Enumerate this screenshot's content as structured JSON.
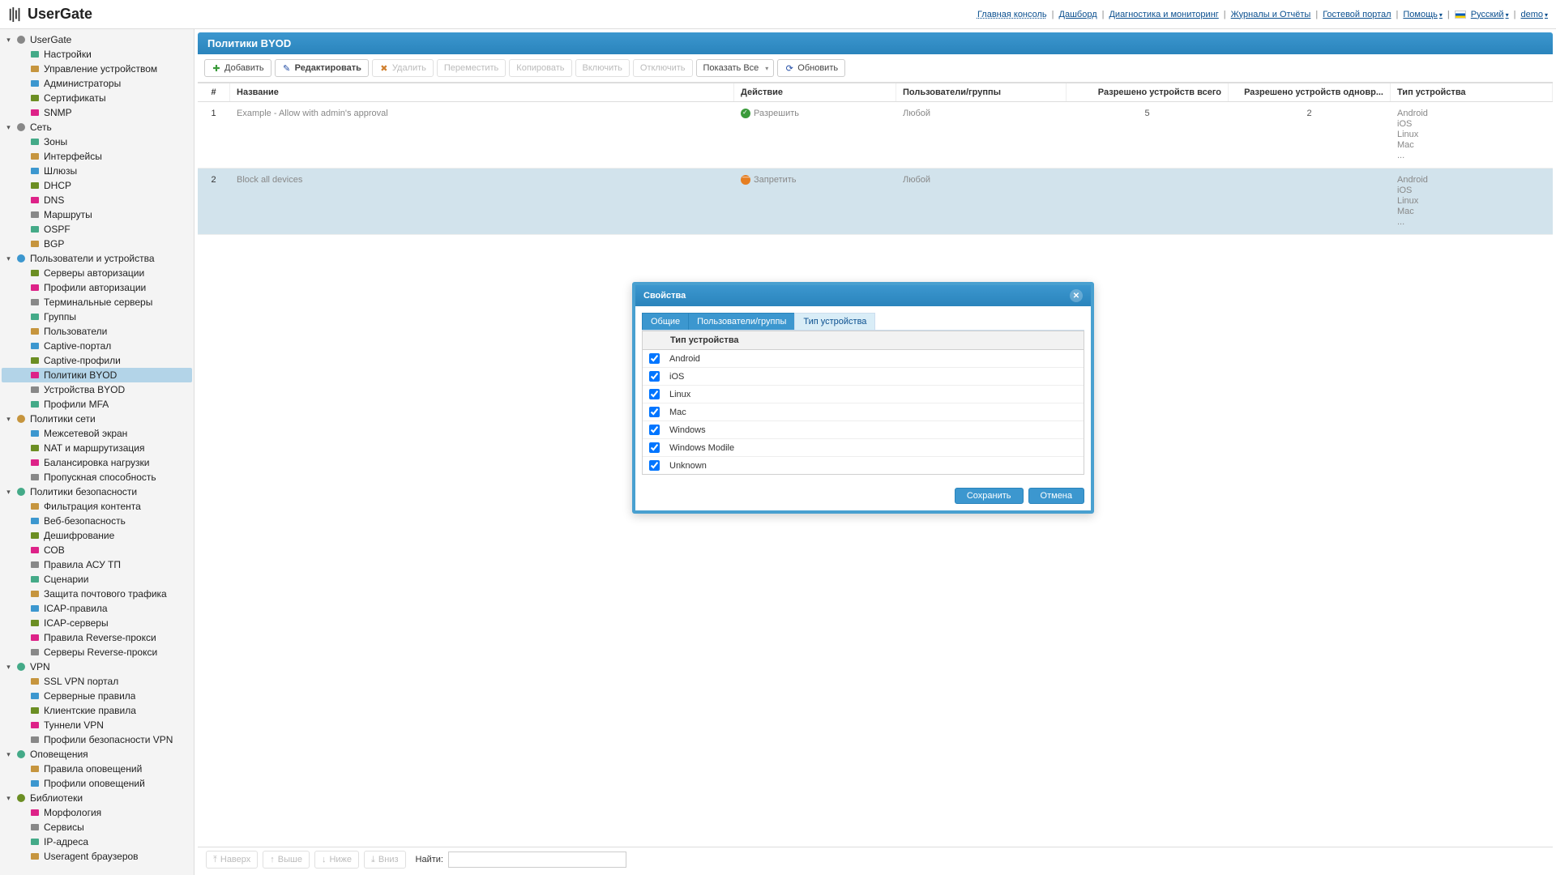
{
  "logo_text": "UserGate",
  "topnav": {
    "main_console": "Главная консоль",
    "dashboard": "Дашборд",
    "diagnostics": "Диагностика и мониторинг",
    "logs_reports": "Журналы и Отчёты",
    "guest_portal": "Гостевой портал",
    "help": "Помощь",
    "language": "Русский",
    "user": "demo"
  },
  "sidebar": [
    {
      "id": "usergate",
      "label": "UserGate",
      "type": "group",
      "children": [
        {
          "id": "settings",
          "label": "Настройки"
        },
        {
          "id": "device-mgmt",
          "label": "Управление устройством"
        },
        {
          "id": "admins",
          "label": "Администраторы"
        },
        {
          "id": "certs",
          "label": "Сертификаты"
        },
        {
          "id": "snmp",
          "label": "SNMP"
        }
      ]
    },
    {
      "id": "network",
      "label": "Сеть",
      "type": "group",
      "children": [
        {
          "id": "zones",
          "label": "Зоны"
        },
        {
          "id": "interfaces",
          "label": "Интерфейсы"
        },
        {
          "id": "gateways",
          "label": "Шлюзы"
        },
        {
          "id": "dhcp",
          "label": "DHCP"
        },
        {
          "id": "dns",
          "label": "DNS"
        },
        {
          "id": "routes",
          "label": "Маршруты"
        },
        {
          "id": "ospf",
          "label": "OSPF"
        },
        {
          "id": "bgp",
          "label": "BGP"
        }
      ]
    },
    {
      "id": "users-devices",
      "label": "Пользователи и устройства",
      "type": "group",
      "children": [
        {
          "id": "auth-servers",
          "label": "Серверы авторизации"
        },
        {
          "id": "auth-profiles",
          "label": "Профили авторизации"
        },
        {
          "id": "terminal-servers",
          "label": "Терминальные серверы"
        },
        {
          "id": "groups",
          "label": "Группы"
        },
        {
          "id": "users",
          "label": "Пользователи"
        },
        {
          "id": "captive-portal",
          "label": "Captive-портал"
        },
        {
          "id": "captive-profiles",
          "label": "Captive-профили"
        },
        {
          "id": "byod-policies",
          "label": "Политики BYOD",
          "selected": true
        },
        {
          "id": "byod-devices",
          "label": "Устройства BYOD"
        },
        {
          "id": "mfa-profiles",
          "label": "Профили MFA"
        }
      ]
    },
    {
      "id": "network-policies",
      "label": "Политики сети",
      "type": "group",
      "children": [
        {
          "id": "firewall",
          "label": "Межсетевой экран"
        },
        {
          "id": "nat",
          "label": "NAT и маршрутизация"
        },
        {
          "id": "load-balance",
          "label": "Балансировка нагрузки"
        },
        {
          "id": "bandwidth",
          "label": "Пропускная способность"
        }
      ]
    },
    {
      "id": "security-policies",
      "label": "Политики безопасности",
      "type": "group",
      "children": [
        {
          "id": "content-filter",
          "label": "Фильтрация контента"
        },
        {
          "id": "web-security",
          "label": "Веб-безопасность"
        },
        {
          "id": "ssl-inspection",
          "label": "Дешифрование"
        },
        {
          "id": "sob",
          "label": "СОВ"
        },
        {
          "id": "scada",
          "label": "Правила АСУ ТП"
        },
        {
          "id": "scenarios",
          "label": "Сценарии"
        },
        {
          "id": "mail-security",
          "label": "Защита почтового трафика"
        },
        {
          "id": "icap-rules",
          "label": "ICAP-правила"
        },
        {
          "id": "icap-servers",
          "label": "ICAP-серверы"
        },
        {
          "id": "reverse-proxy-rules",
          "label": "Правила Reverse-прокси"
        },
        {
          "id": "reverse-proxy-servers",
          "label": "Серверы Reverse-прокси"
        }
      ]
    },
    {
      "id": "vpn",
      "label": "VPN",
      "type": "group",
      "children": [
        {
          "id": "ssl-vpn-portal",
          "label": "SSL VPN портал"
        },
        {
          "id": "server-rules",
          "label": "Серверные правила"
        },
        {
          "id": "client-rules",
          "label": "Клиентские правила"
        },
        {
          "id": "vpn-tunnels",
          "label": "Туннели VPN"
        },
        {
          "id": "vpn-security-profiles",
          "label": "Профили безопасности VPN"
        }
      ]
    },
    {
      "id": "alerts",
      "label": "Оповещения",
      "type": "group",
      "children": [
        {
          "id": "alert-rules",
          "label": "Правила оповещений"
        },
        {
          "id": "alert-profiles",
          "label": "Профили оповещений"
        }
      ]
    },
    {
      "id": "libraries",
      "label": "Библиотеки",
      "type": "group",
      "children": [
        {
          "id": "morphology",
          "label": "Морфология"
        },
        {
          "id": "services",
          "label": "Сервисы"
        },
        {
          "id": "ip-addresses",
          "label": "IP-адреса"
        },
        {
          "id": "useragent",
          "label": "Useragent браузеров"
        }
      ]
    }
  ],
  "page_title": "Политики BYOD",
  "toolbar": {
    "add": "Добавить",
    "edit": "Редактировать",
    "delete": "Удалить",
    "move": "Переместить",
    "copy": "Копировать",
    "enable": "Включить",
    "disable": "Отключить",
    "show_all": "Показать Все",
    "refresh": "Обновить"
  },
  "columns": {
    "num": "#",
    "name": "Название",
    "action": "Действие",
    "users": "Пользователи/группы",
    "allowed_total": "Разрешено устройств всего",
    "allowed_one": "Разрешено устройств одновр...",
    "device_type": "Тип устройства"
  },
  "actions": {
    "allow": "Разрешить",
    "deny": "Запретить"
  },
  "rows": [
    {
      "num": "1",
      "name": "Example - Allow with admin's approval",
      "action": "allow",
      "users": "Любой",
      "total": "5",
      "one": "2",
      "devices": [
        "Android",
        "iOS",
        "Linux",
        "Mac",
        "..."
      ]
    },
    {
      "num": "2",
      "name": "Block all devices",
      "action": "deny",
      "users": "Любой",
      "total": "",
      "one": "",
      "devices": [
        "Android",
        "iOS",
        "Linux",
        "Mac",
        "..."
      ]
    }
  ],
  "footer": {
    "top": "Наверх",
    "up": "Выше",
    "down": "Ниже",
    "bottom": "Вниз",
    "search_label": "Найти:"
  },
  "dialog": {
    "title": "Свойства",
    "tabs": {
      "general": "Общие",
      "users_groups": "Пользователи/группы",
      "device_type": "Тип устройства"
    },
    "grid_header": "Тип устройства",
    "device_types": [
      "Android",
      "iOS",
      "Linux",
      "Mac",
      "Windows",
      "Windows Modile",
      "Unknown"
    ],
    "save": "Сохранить",
    "cancel": "Отмена"
  }
}
